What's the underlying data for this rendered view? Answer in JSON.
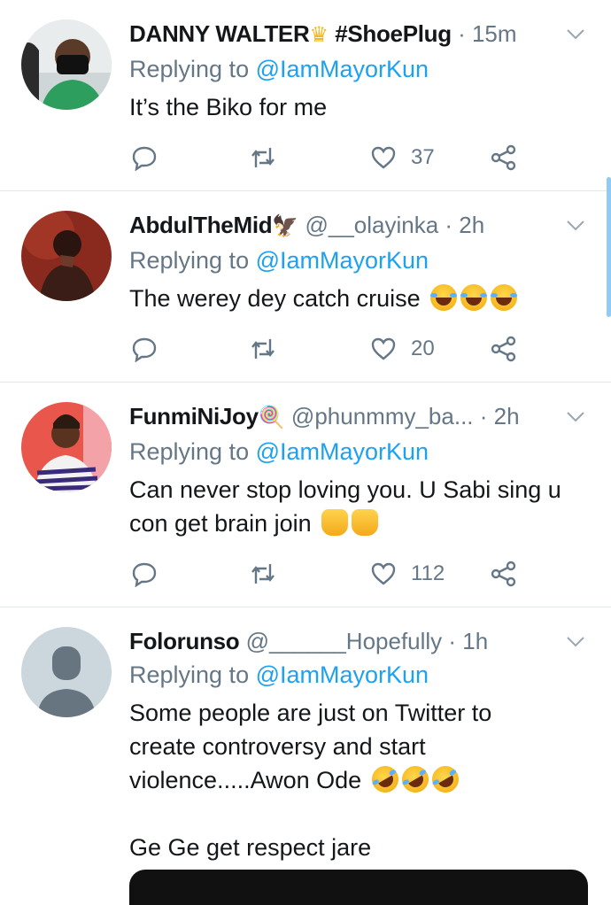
{
  "tweets": [
    {
      "name": "DANNY WALTER",
      "name_suffix": "#ShoePlug",
      "handle": "",
      "time": "15m",
      "replying_prefix": "Replying to ",
      "replying_to": "@IamMayorKun",
      "text": [
        "It’s the Biko for me"
      ],
      "likes": "37"
    },
    {
      "name": "AbdulTheMid",
      "name_suffix": "",
      "handle": "@__olayinka",
      "time": "2h",
      "replying_prefix": "Replying to ",
      "replying_to": "@IamMayorKun",
      "text": [
        "The werey dey catch cruise"
      ],
      "likes": "20"
    },
    {
      "name": "FunmiNiJoy",
      "name_suffix": "",
      "handle": "@phunmmy_ba...",
      "time": "2h",
      "replying_prefix": "Replying to ",
      "replying_to": "@IamMayorKun",
      "text": [
        "Can never stop loving you. U Sabi sing u",
        "con get brain join"
      ],
      "likes": "112"
    },
    {
      "name": "Folorunso",
      "name_suffix": "",
      "handle": "@______Hopefully",
      "time": "1h",
      "replying_prefix": "Replying to ",
      "replying_to": "@IamMayorKun",
      "text": [
        "Some people are just on Twitter to",
        "create controversy and start",
        "violence.....Awon Ode",
        "",
        "Ge Ge get respect jare"
      ],
      "likes": ""
    }
  ],
  "separator": " · ",
  "icons": {
    "reply": "reply-icon",
    "retweet": "retweet-icon",
    "like": "heart-icon",
    "share": "share-icon",
    "menu": "chevron-down-icon"
  },
  "colors": {
    "link": "#1da1f2",
    "muted": "#657786",
    "text": "#14171a",
    "divider": "#e1e8ed"
  }
}
